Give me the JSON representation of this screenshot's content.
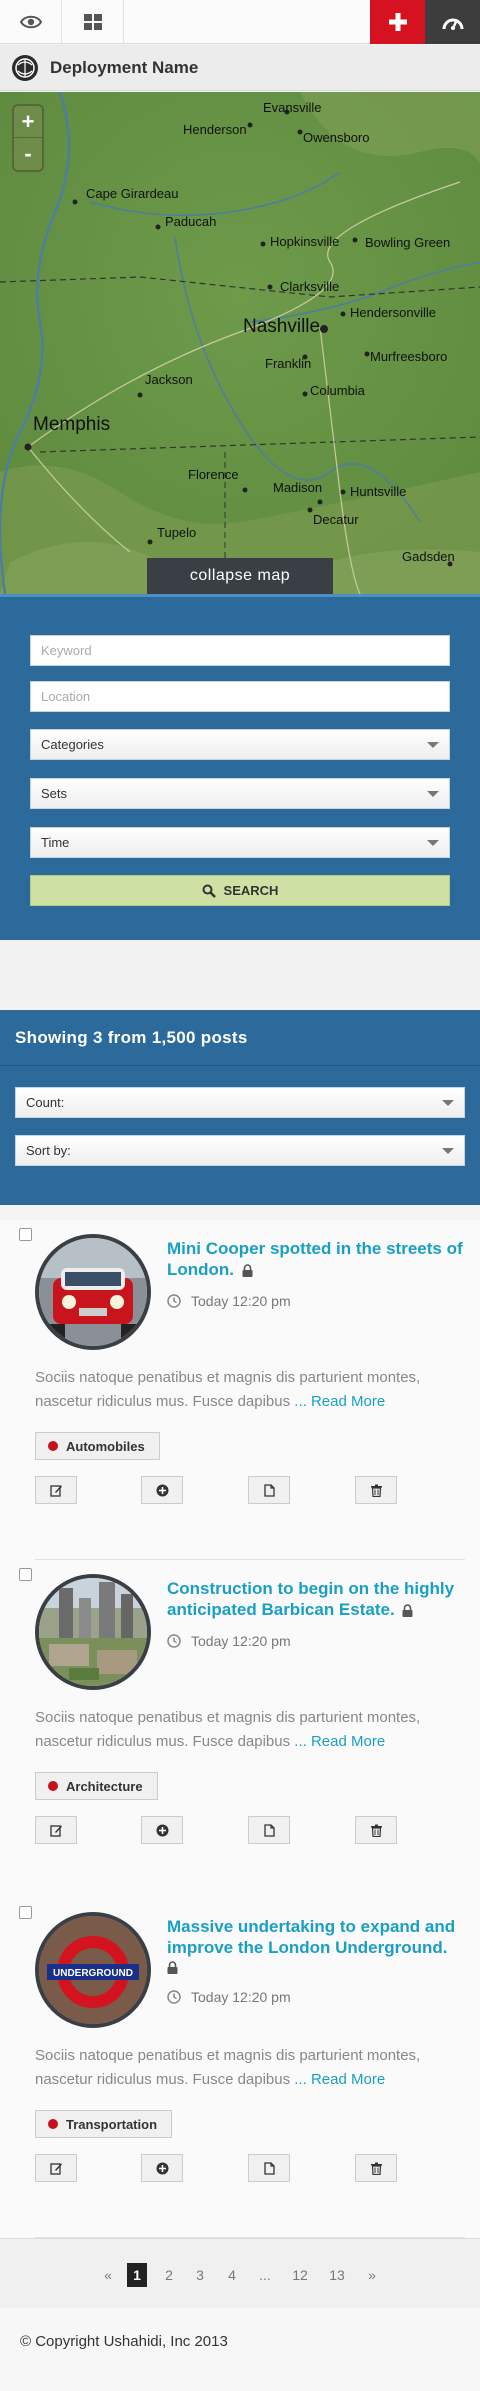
{
  "toolbar": {
    "view_icon": "eye-icon",
    "grid_icon": "grid-icon",
    "add_icon": "plus-icon",
    "dashboard_icon": "dashboard-icon",
    "add_color": "#d5121f",
    "dashboard_color": "#3d3d3d"
  },
  "deployment": {
    "name": "Deployment Name",
    "logo_icon": "ushahidi-logo-icon"
  },
  "map": {
    "zoom_in": "+",
    "zoom_out": "-",
    "collapse_label": "collapse map",
    "cities": [
      {
        "name": "Evansville"
      },
      {
        "name": "Henderson"
      },
      {
        "name": "Owensboro"
      },
      {
        "name": "Cape Girardeau"
      },
      {
        "name": "Paducah"
      },
      {
        "name": "Hopkinsville"
      },
      {
        "name": "Bowling Green"
      },
      {
        "name": "Clarksville"
      },
      {
        "name": "Nashville"
      },
      {
        "name": "Hendersonville"
      },
      {
        "name": "Franklin"
      },
      {
        "name": "Murfreesboro"
      },
      {
        "name": "Jackson"
      },
      {
        "name": "Columbia"
      },
      {
        "name": "Memphis"
      },
      {
        "name": "Florence"
      },
      {
        "name": "Madison"
      },
      {
        "name": "Huntsville"
      },
      {
        "name": "Decatur"
      },
      {
        "name": "Tupelo"
      },
      {
        "name": "Gadsden"
      }
    ]
  },
  "filters": {
    "keyword_placeholder": "Keyword",
    "location_placeholder": "Location",
    "categories_label": "Categories",
    "sets_label": "Sets",
    "time_label": "Time",
    "search_label": "SEARCH",
    "panel_color": "#2d6a9c",
    "search_color": "#cfe0a4"
  },
  "results": {
    "title": "Showing 3 from 1,500 posts",
    "count_label": "Count:",
    "sort_label": "Sort by:"
  },
  "posts": [
    {
      "title": "Mini Cooper spotted in the streets of London.",
      "time": "Today 12:20 pm",
      "body": "Sociis natoque penatibus et magnis dis parturient montes, nascetur ridiculus mus. Fusce dapibus",
      "read_more": "... Read More",
      "tag": "Automobiles"
    },
    {
      "title": "Construction to begin on the highly anticipated Barbican Estate.",
      "time": "Today 12:20 pm",
      "body": "Sociis natoque penatibus et magnis dis parturient montes, nascetur ridiculus mus. Fusce dapibus",
      "read_more": "... Read More",
      "tag": "Architecture"
    },
    {
      "title": "Massive undertaking to expand and improve the London Underground.",
      "time": "Today 12:20 pm",
      "body": "Sociis natoque penatibus et magnis dis parturient montes, nascetur ridiculus mus. Fusce dapibus",
      "read_more": "... Read More",
      "tag": "Transportation",
      "roundel_text": "UNDERGROUND"
    }
  ],
  "post_actions": [
    "edit-icon",
    "add-circle-icon",
    "document-icon",
    "trash-icon"
  ],
  "pagination": {
    "prev": "«",
    "pages": [
      "1",
      "2",
      "3",
      "4",
      "...",
      "12",
      "13"
    ],
    "next": "»",
    "current": "1"
  },
  "footer": {
    "copyright": "© Copyright Ushahidi, Inc 2013"
  }
}
